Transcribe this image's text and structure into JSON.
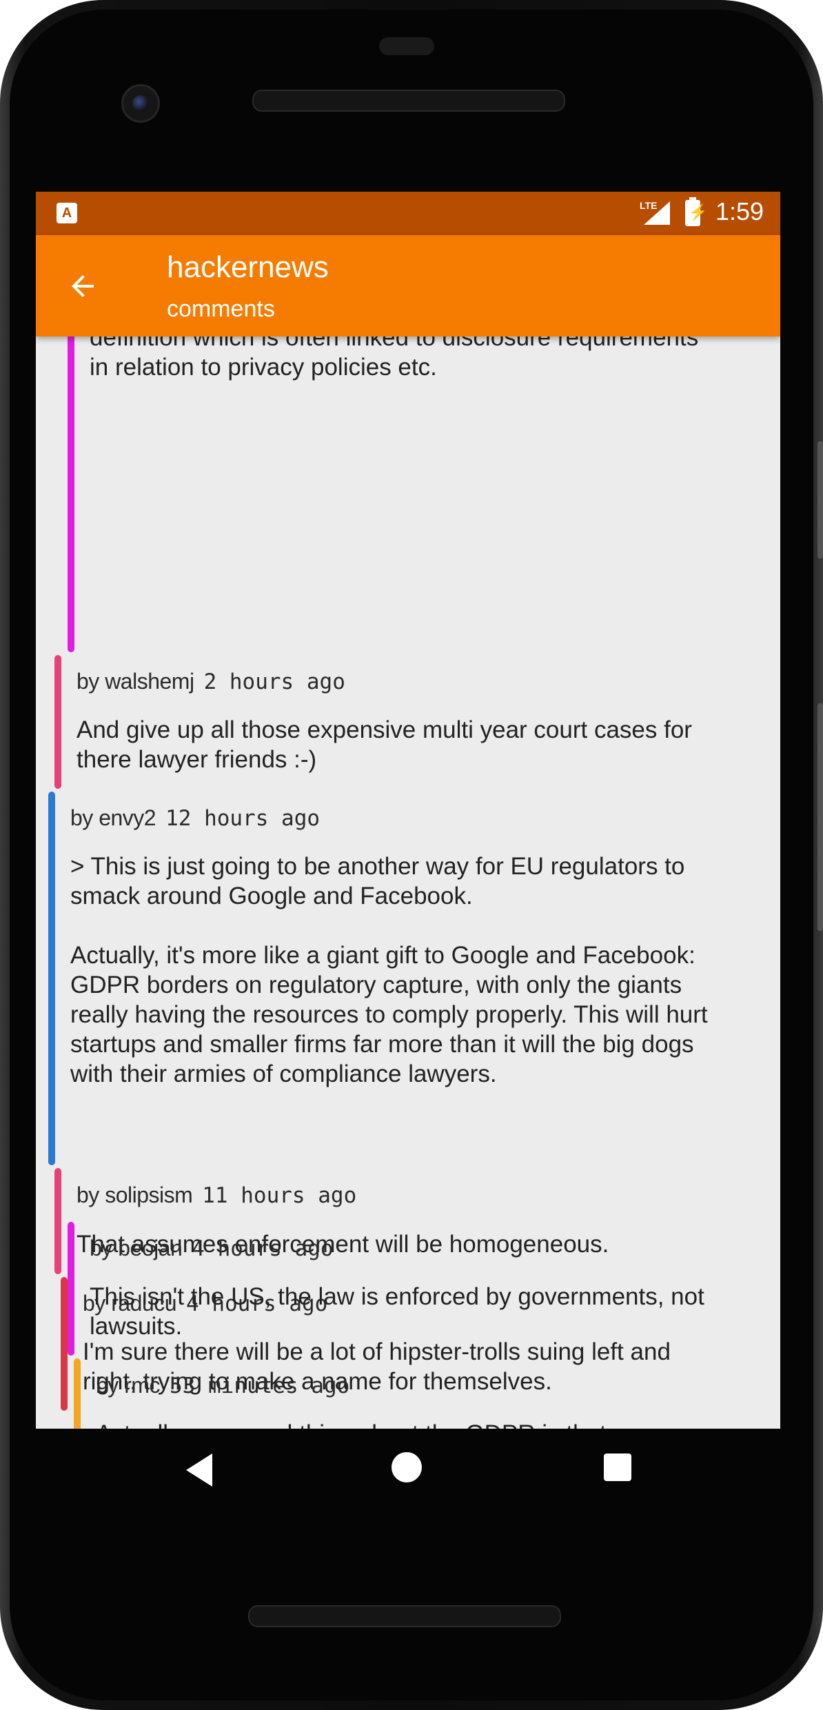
{
  "status_bar": {
    "time": "1:59",
    "network": "LTE"
  },
  "app_bar": {
    "title": "hackernews",
    "subtitle": "comments"
  },
  "comments": [
    {
      "partial_text": "definition which is often linked to disclosure requirements\nin relation to privacy policies etc.",
      "bar_color": "#e01ee0"
    },
    {
      "by": "by walshemj",
      "ago": "2 hours ago",
      "text": "And give up all those expensive multi year court cases for\nthere lawyer friends :-)",
      "bar_color": "#e64078"
    },
    {
      "by": "by envy2",
      "ago": "12 hours ago",
      "text": "> This is just going to be another way for EU regulators to\nsmack around Google and Facebook.\n\nActually, it's more like a giant gift to Google and Facebook:\nGDPR borders on regulatory capture, with only the giants\nreally having the resources to comply properly. This will hurt\nstartups and smaller firms far more than it will the big dogs\nwith their armies of compliance lawyers.",
      "bar_color": "#2a7ad2"
    },
    {
      "by": "by solipsism",
      "ago": "11 hours ago",
      "text": "That assumes enforcement will be homogeneous.",
      "bar_color": "#e64078"
    },
    {
      "by": "by raducu",
      "ago": "4 hours ago",
      "text": "I'm sure there will be a lot of hipster-trolls suing left and\nright, trying to make a name for themselves.",
      "bar_color": "#d93848"
    },
    {
      "by": "by beojan",
      "ago": "4 hours ago",
      "text": "This isn't the US, the law is enforced by governments, not\nlawsuits.",
      "bar_color": "#e01ee0"
    },
    {
      "by": "by rmc",
      "ago": "53 minutes ago",
      "text": "Actually, one good thing about the GDPR is that",
      "bar_color": "#f5a623"
    }
  ],
  "nav": {
    "back": "back-icon",
    "home": "home-icon",
    "recents": "recents-icon"
  }
}
